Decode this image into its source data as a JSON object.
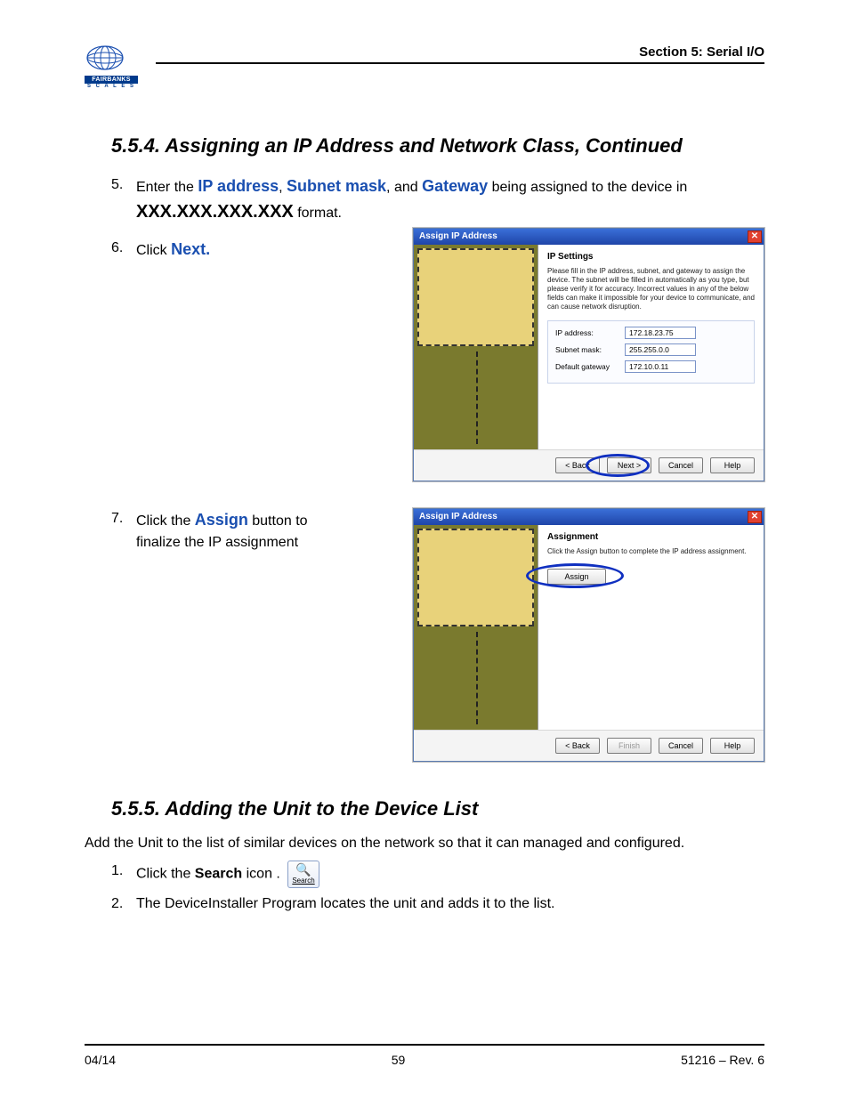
{
  "header": {
    "section": "Section 5: Serial I/O",
    "logo_text": "FAIRBANKS",
    "logo_sub": "S C A L E S"
  },
  "h554": "5.5.4.  Assigning an IP Address and Network Class, Continued",
  "h555": "5.5.5.  Adding the Unit to the Device List",
  "step5": {
    "num": "5.",
    "pre": "Enter the ",
    "kw1": "IP address",
    "sep1": ", ",
    "kw2": "Subnet mask",
    "sep2": ", and ",
    "kw3": "Gateway",
    "post1": " being assigned to the device in ",
    "fmt": "XXX.XXX.XXX.XXX",
    "post2": " format."
  },
  "step6": {
    "num": "6.",
    "pre": "Click ",
    "kw": "Next."
  },
  "step7": {
    "num": "7.",
    "pre": "Click the ",
    "kw": "Assign",
    "post": " button to finalize the IP assignment"
  },
  "dialog1": {
    "title": "Assign IP Address",
    "close": "✕",
    "heading": "IP Settings",
    "desc": "Please fill in the IP address, subnet, and gateway to assign the device. The subnet will be filled in automatically as you type, but please verify it for accuracy. Incorrect values in any of the below fields can make it impossible for your device to communicate, and can cause network disruption.",
    "ip_label": "IP address:",
    "ip_value": "172.18.23.75",
    "subnet_label": "Subnet mask:",
    "subnet_value": "255.255.0.0",
    "gw_label": "Default gateway",
    "gw_value": "172.10.0.11",
    "back": "< Back",
    "next": "Next >",
    "cancel": "Cancel",
    "help": "Help"
  },
  "dialog2": {
    "title": "Assign IP Address",
    "close": "✕",
    "heading": "Assignment",
    "desc": "Click the Assign button to complete the IP address assignment.",
    "assign": "Assign",
    "back": "< Back",
    "finish": "Finish",
    "cancel": "Cancel",
    "help": "Help"
  },
  "sec555_intro": "Add the Unit to the list of similar devices on the network so that it can managed and configured.",
  "sec555_s1": {
    "num": "1.",
    "pre": "Click the ",
    "kw": "Search",
    "post": " icon ."
  },
  "sec555_s2": {
    "num": "2.",
    "text": "The DeviceInstaller Program locates the unit and adds it to the list."
  },
  "search_icon_label": "Search",
  "footer": {
    "left": "04/14",
    "center": "59",
    "right": "51216 – Rev. 6"
  }
}
